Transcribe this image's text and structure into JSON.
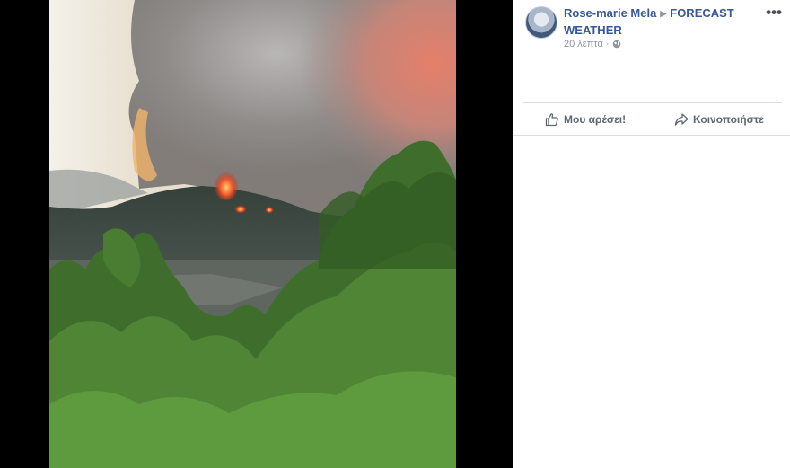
{
  "post": {
    "author": "Rose-marie Mela",
    "separator_icon": "triangle-right-icon",
    "target": "FORECAST WEATHER",
    "time": "20 λεπτά",
    "dot": "·",
    "privacy_icon": "globe-icon",
    "more_label": "•••"
  },
  "actions": {
    "like_label": "Μου αρέσει!",
    "like_icon": "thumbs-up-icon",
    "share_label": "Κοινοποιήστε",
    "share_icon": "share-arrow-icon"
  },
  "photo": {
    "description_icon": "wildfire-photo"
  },
  "colors": {
    "link": "#365899",
    "meta": "#90949c",
    "action": "#606770",
    "viewer_bg": "#000000"
  }
}
